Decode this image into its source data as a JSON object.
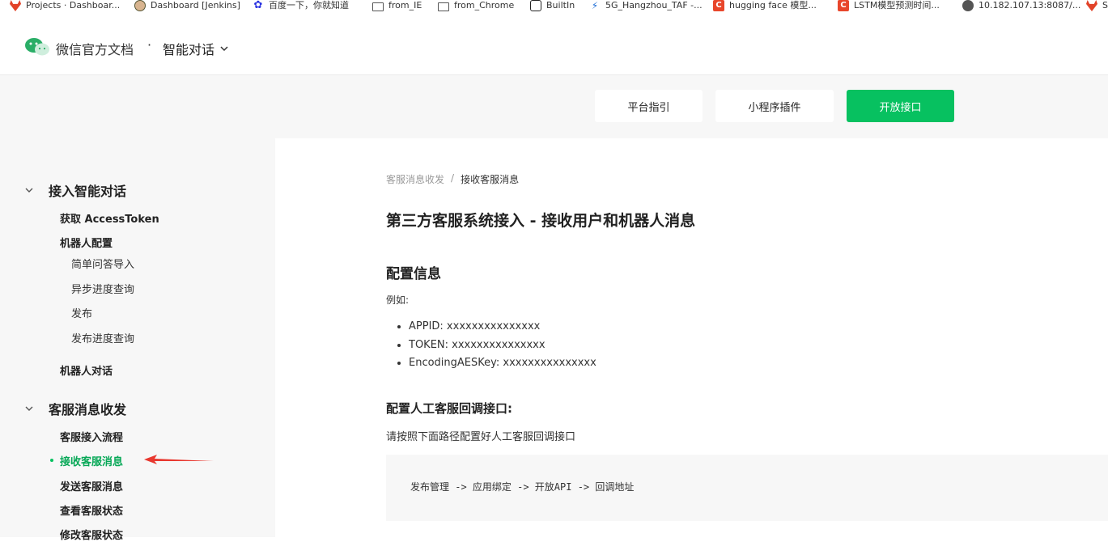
{
  "bookmarks": [
    {
      "label": "Projects · Dashboar...",
      "icon": "gitlab-icon"
    },
    {
      "label": "Dashboard [Jenkins]",
      "icon": "jenkins-icon"
    },
    {
      "label": "百度一下，你就知道",
      "icon": "baidu-icon"
    },
    {
      "label": "from_IE",
      "icon": "folder-icon"
    },
    {
      "label": "from_Chrome",
      "icon": "folder-icon"
    },
    {
      "label": "BuiltIn",
      "icon": "builtin-icon"
    },
    {
      "label": "5G_Hangzhou_TAF -...",
      "icon": "5g-icon"
    },
    {
      "label": "hugging face 模型...",
      "icon": "csdn-icon"
    },
    {
      "label": "LSTM模型预测时间...",
      "icon": "csdn-icon"
    },
    {
      "label": "10.182.107.13:8087/...",
      "icon": "globe-icon"
    },
    {
      "label": "S",
      "icon": "gitlab-icon"
    }
  ],
  "header": {
    "site_title": "微信官方文档",
    "separator": "·",
    "product": "智能对话"
  },
  "actions": {
    "platform_guide": "平台指引",
    "miniprogram_plugin": "小程序插件",
    "open_api": "开放接口"
  },
  "sidebar": {
    "section1": {
      "title": "接入智能对话",
      "get_token": "获取 AccessToken",
      "robot_config": "机器人配置",
      "qa_import": "简单问答导入",
      "async_progress": "异步进度查询",
      "publish": "发布",
      "publish_progress": "发布进度查询",
      "robot_chat": "机器人对话"
    },
    "section2": {
      "title": "客服消息收发",
      "access_flow": "客服接入流程",
      "receive_msg": "接收客服消息",
      "send_msg": "发送客服消息",
      "check_status": "查看客服状态",
      "modify_status": "修改客服状态"
    }
  },
  "content": {
    "breadcrumb": {
      "parent": "客服消息收发",
      "separator": "/",
      "current": "接收客服消息"
    },
    "title": "第三方客服系统接入 - 接收用户和机器人消息",
    "config_heading": "配置信息",
    "example_label": "例如:",
    "config_items": [
      "APPID: xxxxxxxxxxxxxxx",
      "TOKEN: xxxxxxxxxxxxxxx",
      "EncodingAESKey: xxxxxxxxxxxxxxx"
    ],
    "callback_heading": "配置人工客服回调接口:",
    "callback_desc": "请按照下面路径配置好人工客服回调接口",
    "callback_path": "发布管理 -> 应用绑定 -> 开放API -> 回调地址"
  },
  "colors": {
    "brand_green": "#07c160",
    "annotation_red": "#e8382f"
  }
}
